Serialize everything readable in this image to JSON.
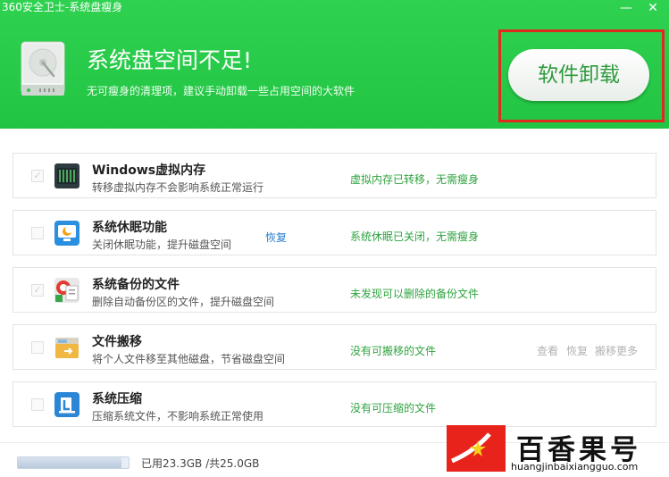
{
  "window": {
    "title": "360安全卫士-系统盘瘦身",
    "minimize": "—",
    "close": "✕"
  },
  "header": {
    "headline": "系统盘空间不足!",
    "subline": "无可瘦身的清理项，建议手动卸载一些占用空间的大软件",
    "uninstall_button": "软件卸载",
    "icon": "hard-disk-icon"
  },
  "items": [
    {
      "name": "Windows虚拟内存",
      "desc": "转移虚拟内存不会影响系统正常运行",
      "status": "虚拟内存已转移，无需瘦身",
      "checked": "✓",
      "icon": "memory-chip-icon"
    },
    {
      "name": "系统休眠功能",
      "desc": "关闭休眠功能，提升磁盘空间",
      "restore": "恢复",
      "status": "系统休眠已关闭，无需瘦身",
      "checked": "",
      "icon": "sleep-monitor-icon"
    },
    {
      "name": "系统备份的文件",
      "desc": "删除自动备份区的文件，提升磁盘空间",
      "status": "未发现可以删除的备份文件",
      "checked": "✓",
      "icon": "backup-files-icon"
    },
    {
      "name": "文件搬移",
      "desc": "将个人文件移至其他磁盘，节省磁盘空间",
      "status": "没有可搬移的文件",
      "actions": [
        "查看",
        "恢复",
        "搬移更多"
      ],
      "checked": "",
      "icon": "folder-move-icon"
    },
    {
      "name": "系统压缩",
      "desc": "压缩系统文件，不影响系统正常使用",
      "status": "没有可压缩的文件",
      "checked": "",
      "icon": "compress-icon"
    }
  ],
  "footer": {
    "usage": "已用23.3GB /共25.0GB",
    "used_fraction": 0.932
  },
  "watermark": {
    "title": "百香果号",
    "url": "huangjinbaixiangguo.com"
  },
  "colors": {
    "header_green": "#27c946",
    "status_green": "#2ea33f",
    "highlight_red": "#e02a1d",
    "link_blue": "#2a7fd0"
  }
}
